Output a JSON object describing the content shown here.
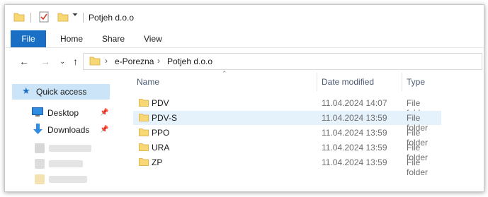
{
  "window": {
    "title": "Potjeh d.o.o"
  },
  "ribbon": {
    "tabs": [
      "File",
      "Home",
      "Share",
      "View"
    ]
  },
  "address": {
    "crumbs": [
      "e-Porezna",
      "Potjeh d.o.o"
    ]
  },
  "nav": {
    "quick_access": "Quick access",
    "items": [
      {
        "label": "Desktop",
        "icon": "desktop-icon"
      },
      {
        "label": "Downloads",
        "icon": "download-arrow-icon"
      }
    ]
  },
  "columns": {
    "name": "Name",
    "date": "Date modified",
    "type": "Type"
  },
  "files": [
    {
      "name": "PDV",
      "date": "11.04.2024 14:07",
      "type": "File folder"
    },
    {
      "name": "PDV-S",
      "date": "11.04.2024 13:59",
      "type": "File folder"
    },
    {
      "name": "PPO",
      "date": "11.04.2024 13:59",
      "type": "File folder"
    },
    {
      "name": "URA",
      "date": "11.04.2024 13:59",
      "type": "File folder"
    },
    {
      "name": "ZP",
      "date": "11.04.2024 13:59",
      "type": "File folder"
    }
  ],
  "colors": {
    "accent": "#1a6fc4",
    "selection": "#cce4f7",
    "hover": "#e5f1fb",
    "folder": "#f8d775"
  }
}
